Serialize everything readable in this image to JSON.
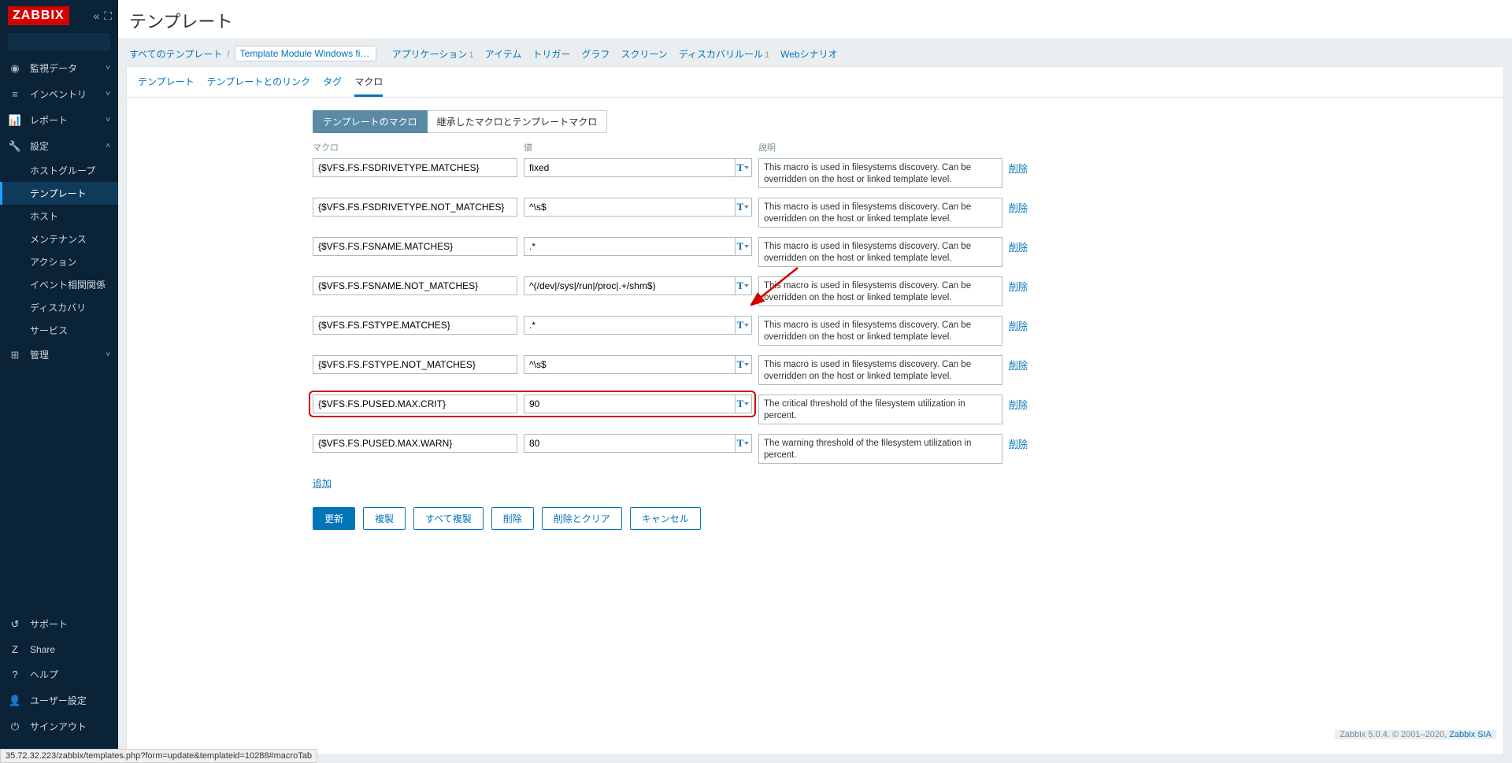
{
  "logo": "ZABBIX",
  "sidebar": {
    "nav": [
      {
        "icon": "◉",
        "label": "監視データ",
        "expand": "˅"
      },
      {
        "icon": "≡",
        "label": "インベントリ",
        "expand": "˅"
      },
      {
        "icon": "📊",
        "label": "レポート",
        "expand": "˅"
      },
      {
        "icon": "🔧",
        "label": "設定",
        "expand": "˄"
      }
    ],
    "setup_sub": [
      {
        "label": "ホストグループ"
      },
      {
        "label": "テンプレート",
        "active": true
      },
      {
        "label": "ホスト"
      },
      {
        "label": "メンテナンス"
      },
      {
        "label": "アクション"
      },
      {
        "label": "イベント相関関係"
      },
      {
        "label": "ディスカバリ"
      },
      {
        "label": "サービス"
      }
    ],
    "admin": {
      "icon": "⊞",
      "label": "管理",
      "expand": "˅"
    },
    "bottom": [
      {
        "icon": "↺",
        "label": "サポート"
      },
      {
        "icon": "Z",
        "label": "Share"
      },
      {
        "icon": "?",
        "label": "ヘルプ"
      },
      {
        "icon": "👤",
        "label": "ユーザー設定"
      },
      {
        "icon": "⏻",
        "label": "サインアウト"
      }
    ]
  },
  "page_title": "テンプレート",
  "breadcrumb": {
    "all": "すべてのテンプレート",
    "current": "Template Module Windows filesys...",
    "items": [
      {
        "label": "アプリケーション",
        "count": "1"
      },
      {
        "label": "アイテム",
        "count": ""
      },
      {
        "label": "トリガー",
        "count": ""
      },
      {
        "label": "グラフ",
        "count": ""
      },
      {
        "label": "スクリーン",
        "count": ""
      },
      {
        "label": "ディスカバリルール",
        "count": "1"
      },
      {
        "label": "Webシナリオ",
        "count": ""
      }
    ]
  },
  "tabs": [
    {
      "label": "テンプレート"
    },
    {
      "label": "テンプレートとのリンク"
    },
    {
      "label": "タグ"
    },
    {
      "label": "マクロ",
      "active": true
    }
  ],
  "seg": {
    "own": "テンプレートのマクロ",
    "inherited": "継承したマクロとテンプレートマクロ"
  },
  "headers": {
    "macro": "マクロ",
    "value": "値",
    "desc": "説明"
  },
  "macros": [
    {
      "name": "{$VFS.FS.FSDRIVETYPE.MATCHES}",
      "value": "fixed",
      "desc": "This macro is used in filesystems discovery. Can be overridden on the host or linked template level."
    },
    {
      "name": "{$VFS.FS.FSDRIVETYPE.NOT_MATCHES}",
      "value": "^\\s$",
      "desc": "This macro is used in filesystems discovery. Can be overridden on the host or linked template level."
    },
    {
      "name": "{$VFS.FS.FSNAME.MATCHES}",
      "value": ".*",
      "desc": "This macro is used in filesystems discovery. Can be overridden on the host or linked template level."
    },
    {
      "name": "{$VFS.FS.FSNAME.NOT_MATCHES}",
      "value": "^(/dev|/sys|/run|/proc|.+/shm$)",
      "desc": "This macro is used in filesystems discovery. Can be overridden on the host or linked template level."
    },
    {
      "name": "{$VFS.FS.FSTYPE.MATCHES}",
      "value": ".*",
      "desc": "This macro is used in filesystems discovery. Can be overridden on the host or linked template level."
    },
    {
      "name": "{$VFS.FS.FSTYPE.NOT_MATCHES}",
      "value": "^\\s$",
      "desc": "This macro is used in filesystems discovery. Can be overridden on the host or linked template level."
    },
    {
      "name": "{$VFS.FS.PUSED.MAX.CRIT}",
      "value": "90",
      "desc": "The critical threshold of the filesystem utilization in percent.",
      "highlight": true
    },
    {
      "name": "{$VFS.FS.PUSED.MAX.WARN}",
      "value": "80",
      "desc": "The warning threshold of the filesystem utilization in percent."
    }
  ],
  "delete_label": "削除",
  "add_label": "追加",
  "buttons": {
    "update": "更新",
    "clone": "複製",
    "full_clone": "すべて複製",
    "delete": "削除",
    "delete_clear": "削除とクリア",
    "cancel": "キャンセル"
  },
  "footer": {
    "text": "Zabbix 5.0.4. © 2001–2020, ",
    "link": "Zabbix SIA"
  },
  "status_url": "35.72.32.223/zabbix/templates.php?form=update&templateid=10288#macroTab"
}
